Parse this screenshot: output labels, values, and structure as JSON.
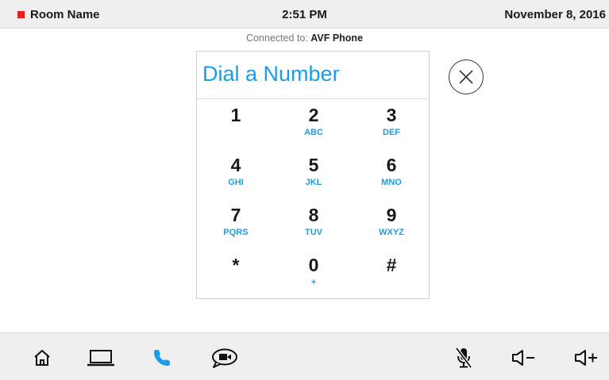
{
  "status_bar": {
    "room_name": "Room Name",
    "time": "2:51 PM",
    "date": "November 8, 2016",
    "room_indicator_color": "#e8201c"
  },
  "connection": {
    "prefix": "Connected to:",
    "device": "AVF Phone"
  },
  "dialer": {
    "title": "Dial a Number",
    "accent_color": "#1e9be7",
    "keys": [
      {
        "digit": "1",
        "letters": ""
      },
      {
        "digit": "2",
        "letters": "ABC"
      },
      {
        "digit": "3",
        "letters": "DEF"
      },
      {
        "digit": "4",
        "letters": "GHI"
      },
      {
        "digit": "5",
        "letters": "JKL"
      },
      {
        "digit": "6",
        "letters": "MNO"
      },
      {
        "digit": "7",
        "letters": "PQRS"
      },
      {
        "digit": "8",
        "letters": "TUV"
      },
      {
        "digit": "9",
        "letters": "WXYZ"
      },
      {
        "digit": "*",
        "letters": ""
      },
      {
        "digit": "0",
        "letters": "+"
      },
      {
        "digit": "#",
        "letters": ""
      }
    ],
    "close_icon": "close-circle-icon"
  },
  "bottom_nav": {
    "icons": [
      "home-icon",
      "laptop-icon",
      "phone-icon",
      "chat-video-icon",
      "mic-muted-icon",
      "volume-down-icon",
      "volume-up-icon"
    ],
    "active": "phone-icon"
  }
}
